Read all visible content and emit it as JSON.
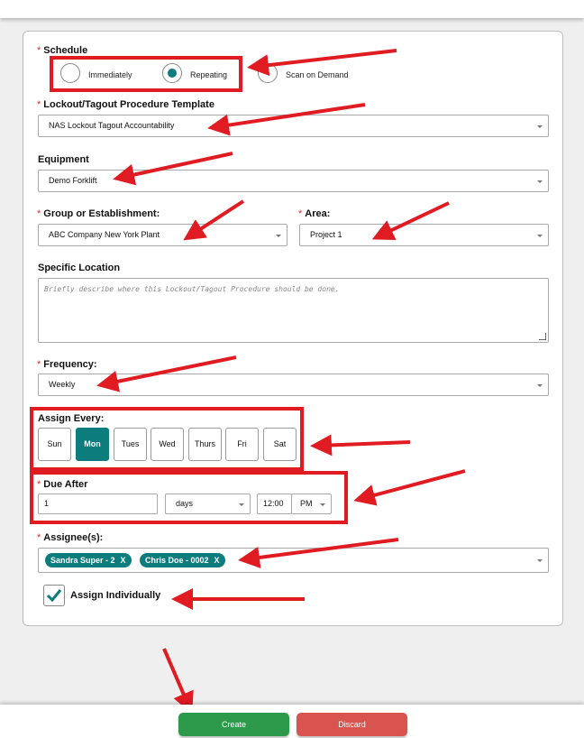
{
  "schedule": {
    "label": "Schedule",
    "options": [
      "Immediately",
      "Repeating",
      "Scan on Demand"
    ],
    "selected": "Repeating"
  },
  "template": {
    "label": "Lockout/Tagout Procedure Template",
    "value": "NAS Lockout Tagout Accountability"
  },
  "equipment": {
    "label": "Equipment",
    "value": "Demo Forklift"
  },
  "group": {
    "label": "Group or Establishment:",
    "value": "ABC Company New York Plant"
  },
  "area": {
    "label": "Area:",
    "value": "Project 1"
  },
  "location": {
    "label": "Specific Location",
    "placeholder": "Briefly describe where this Lockout/Tagout Procedure should be done."
  },
  "frequency": {
    "label": "Frequency:",
    "value": "Weekly"
  },
  "assign_every": {
    "label": "Assign Every:",
    "days": [
      "Sun",
      "Mon",
      "Tues",
      "Wed",
      "Thurs",
      "Fri",
      "Sat"
    ],
    "selected": "Mon"
  },
  "due_after": {
    "label": "Due After",
    "amount": "1",
    "unit": "days",
    "time": "12:00",
    "ampm": "PM"
  },
  "assignees": {
    "label": "Assignee(s):",
    "chips": [
      "Sandra Super - 2",
      "Chris Doe - 0002"
    ],
    "remove_glyph": "X"
  },
  "assign_individually": {
    "label": "Assign Individually",
    "checked": true
  },
  "actions": {
    "create": "Create",
    "discard": "Discard"
  },
  "colors": {
    "accent": "#0c7c7c",
    "required": "#d32f2f",
    "annotation": "#e01b22",
    "create": "#2c9a4a",
    "discard": "#d9534f"
  }
}
